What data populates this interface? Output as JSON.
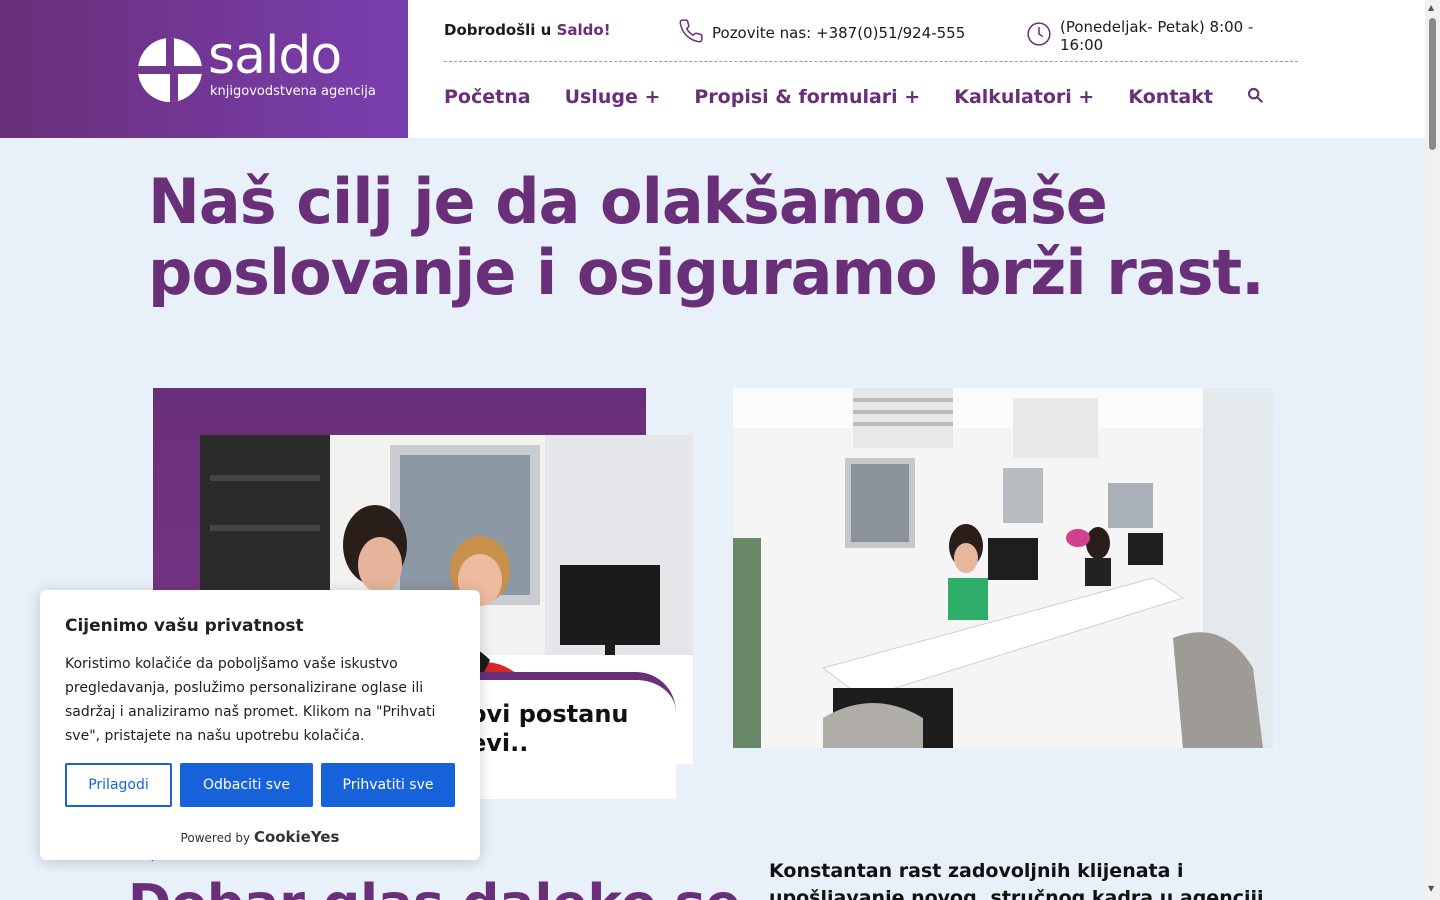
{
  "header": {
    "logo": {
      "word": "saldo",
      "subtitle": "knjigovodstvena agencija"
    },
    "welcome_prefix": "Dobrodošli u ",
    "welcome_brand": "Saldo!",
    "phone_text": "Pozovite nas: +387(0)51/924-555",
    "hours_text": "(Ponedeljak- Petak) 8:00 - 16:00",
    "nav": [
      {
        "label": "Početna"
      },
      {
        "label": "Usluge +"
      },
      {
        "label": "Propisi & formulari +"
      },
      {
        "label": "Kalkulatori +"
      },
      {
        "label": "Kontakt"
      }
    ]
  },
  "hero": {
    "title": "Naš cilj je da olakšamo Vaše poslovanje i osiguramo brži rast."
  },
  "quote_card": {
    "text": "ovi postanu evi.."
  },
  "bottom": {
    "label": "|",
    "heading": "Dobar glas daleko se",
    "paragraph": "Konstantan rast zadovoljnih klijenata i upošljavanje novog, stručnog kadra u agenciji Saldo je osnovni"
  },
  "cookie_banner": {
    "title": "Cijenimo vašu privatnost",
    "text": "Koristimo kolačiće da poboljšamo vaše iskustvo pregledavanja, poslužimo personalizirane oglase ili sadržaj i analiziramo naš promet. Klikom na \"Prihvati sve\", pristajete na našu upotrebu kolačića.",
    "customize_label": "Prilagodi",
    "reject_label": "Odbaciti sve",
    "accept_label": "Prihvatiti sve",
    "powered_by": "Powered by",
    "powered_brand": "CookieYes"
  },
  "colors": {
    "brand_purple": "#6a2f79",
    "cookie_blue": "#1863dc",
    "page_bg": "#e8f0f9"
  },
  "icons": [
    "phone-icon",
    "clock-icon",
    "search-icon"
  ]
}
